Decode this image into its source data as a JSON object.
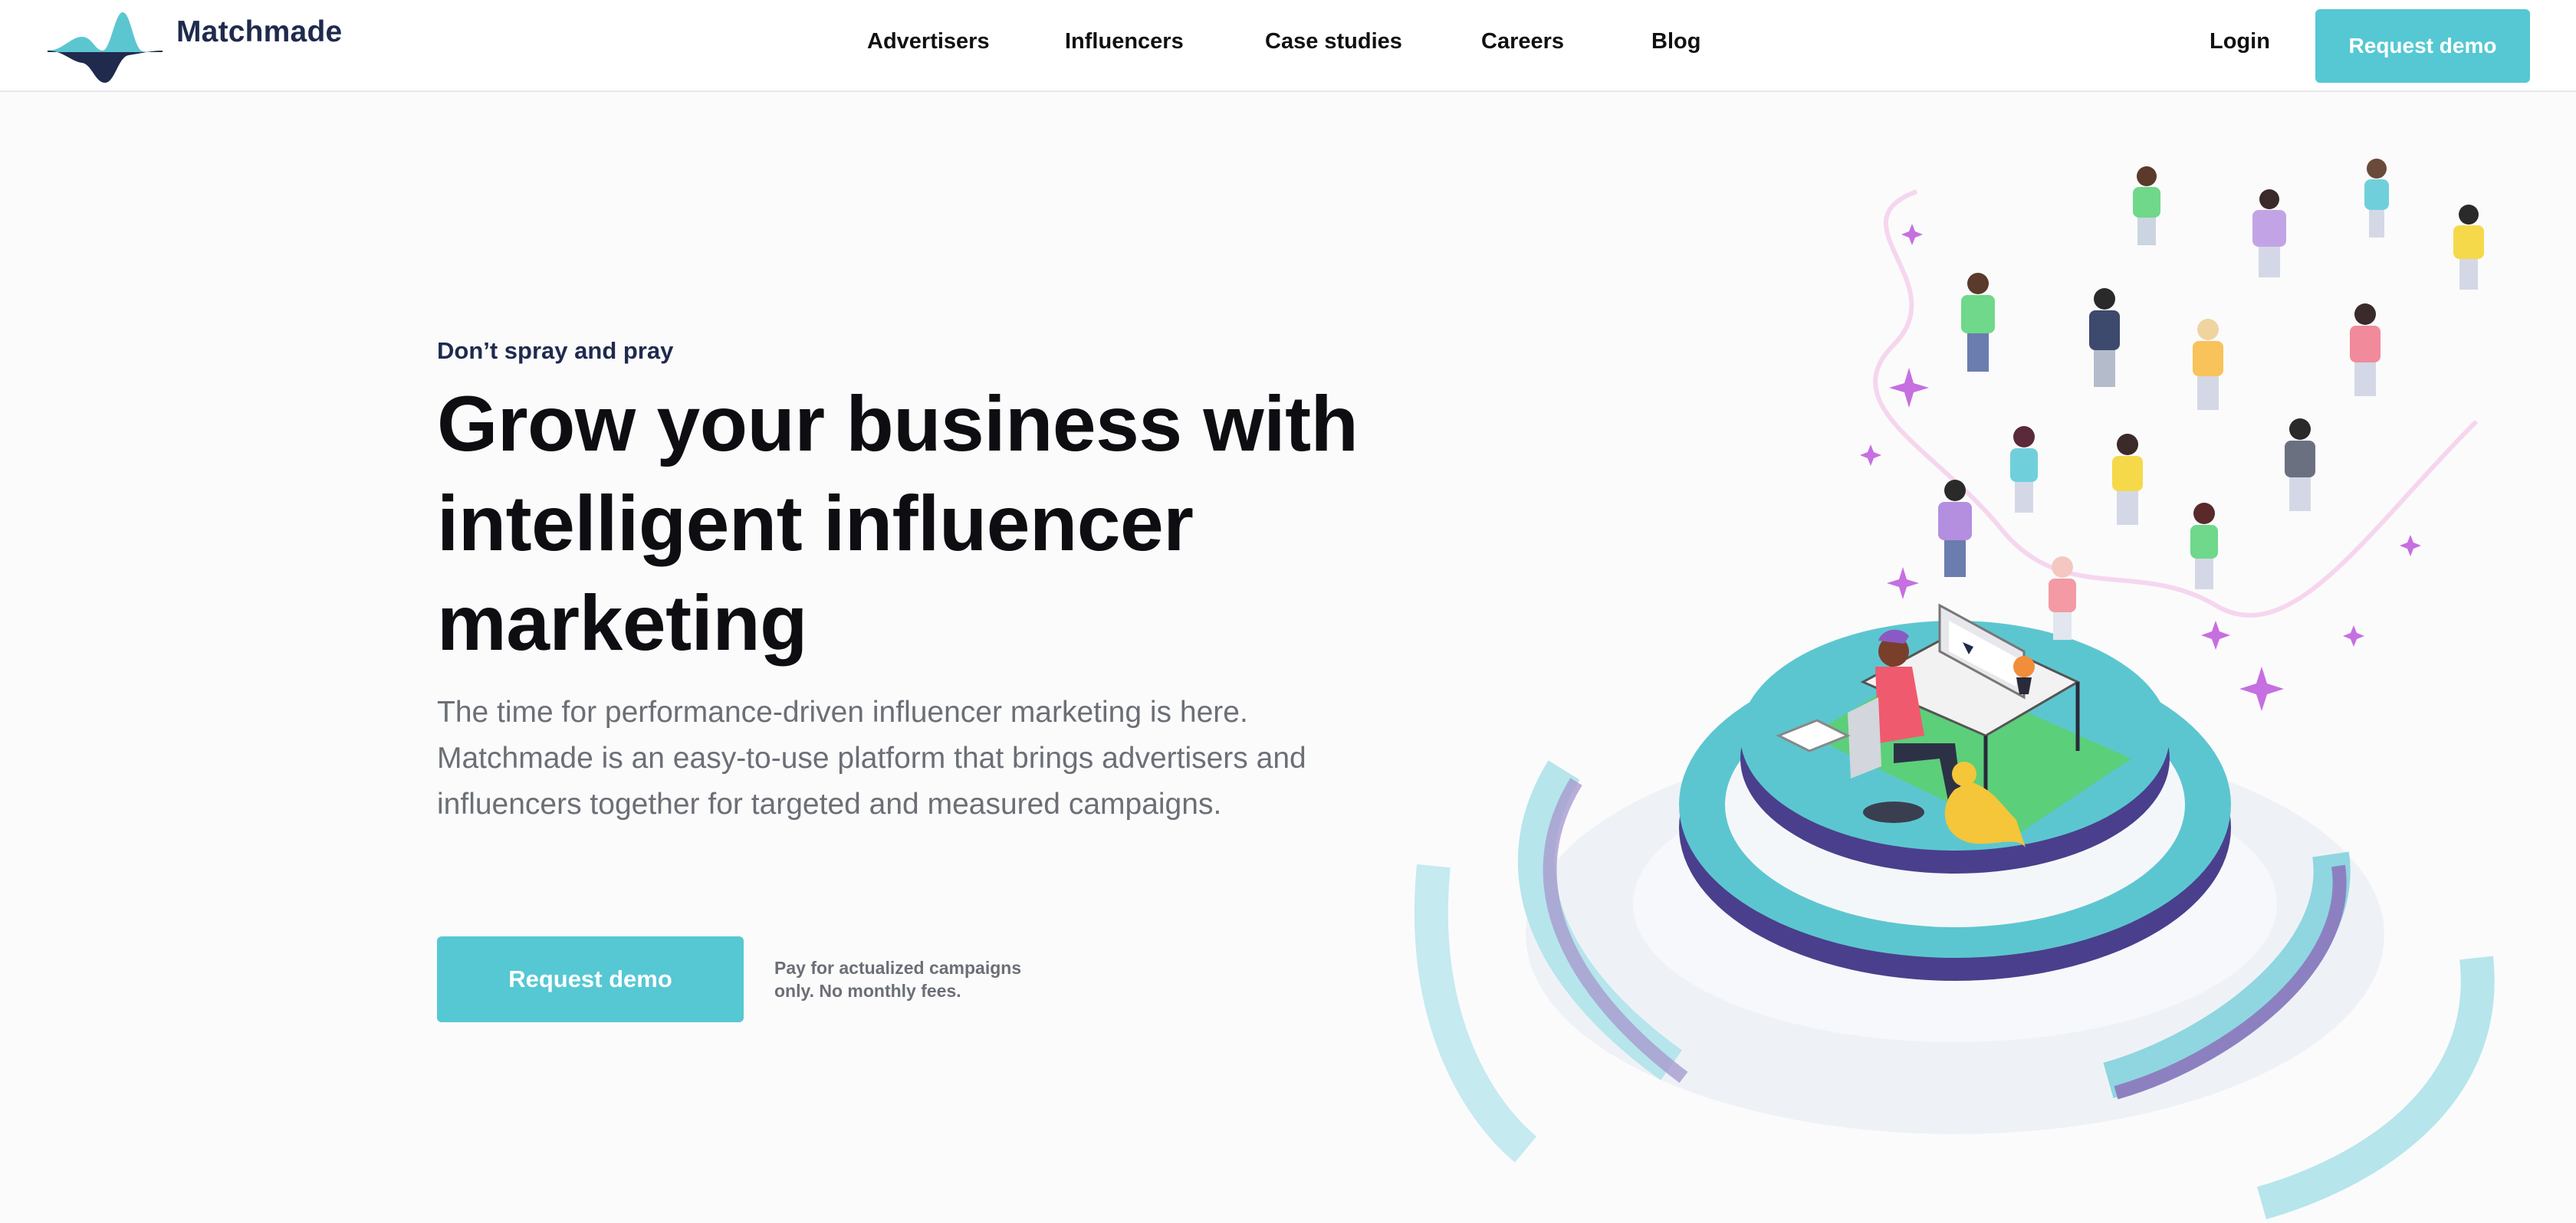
{
  "brand": {
    "name": "Matchmade",
    "logo_icon": "waveform-logo-icon"
  },
  "nav": {
    "items": [
      {
        "label": "Advertisers"
      },
      {
        "label": "Influencers"
      },
      {
        "label": "Case studies"
      },
      {
        "label": "Careers"
      },
      {
        "label": "Blog"
      }
    ],
    "login_label": "Login",
    "demo_label": "Request demo"
  },
  "hero": {
    "eyebrow": "Don’t spray and pray",
    "headline_lines": [
      "Grow your business with",
      "intelligent influencer",
      "marketing"
    ],
    "lead_lines": [
      "The time for performance-driven influencer marketing is here.",
      "Matchmade is an easy-to-use platform that brings advertisers and",
      "influencers together for targeted and measured campaigns."
    ],
    "cta_label": "Request demo",
    "note_lines": [
      "Pay for actualized campaigns",
      "only. No monthly fees."
    ]
  },
  "colors": {
    "accent": "#55c8d3",
    "navy": "#1f2a4d",
    "platform_teal": "#5cc6d0",
    "platform_purple": "#4a3f8c"
  },
  "illustration": {
    "icon": "influencer-crowd-illustration"
  }
}
